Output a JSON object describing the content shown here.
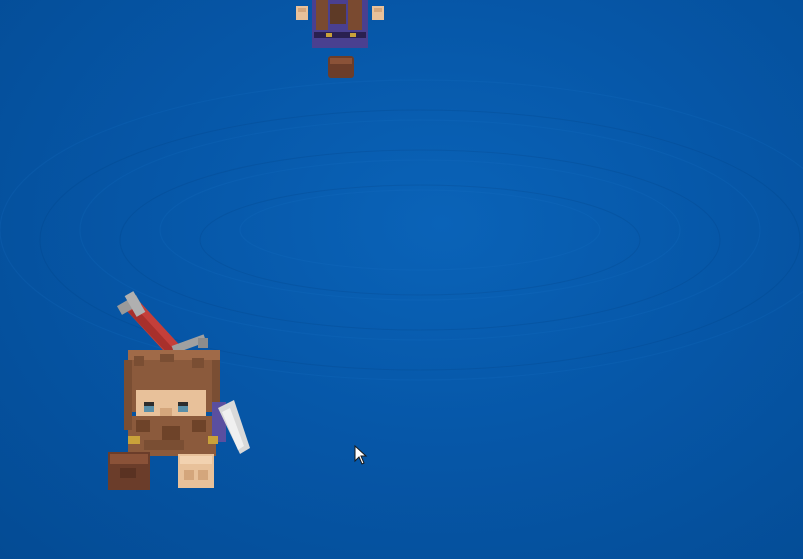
{
  "scene": {
    "background_color": "#0657a8",
    "background_edge_color": "#044b94",
    "background_highlight_color": "#0a63b8"
  },
  "characters": [
    {
      "name": "dwarf-player",
      "icon": "voxel-dwarf-with-axe",
      "hair_color": "#8b5a3c",
      "skin_color": "#e8c19a",
      "tunic_color": "#5a4fa0",
      "weapon_handle_color": "#c43f3a",
      "weapon_metal_color": "#9a9a9a",
      "boot_color": "#6b3d2a"
    },
    {
      "name": "dwarf-distant",
      "icon": "voxel-dwarf-small",
      "hair_color": "#7a4a30",
      "skin_color": "#e8c19a",
      "tunic_color": "#4a4090",
      "boot_color": "#6b3d2a"
    }
  ],
  "cursor": {
    "icon": "mouse-pointer-icon",
    "color": "#ffffff"
  }
}
